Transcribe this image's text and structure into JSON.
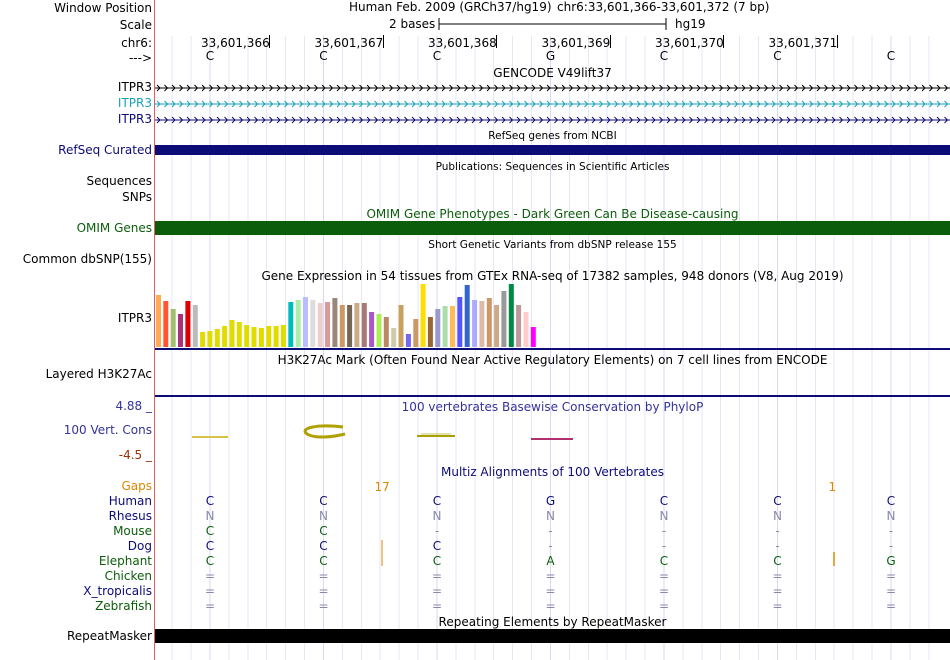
{
  "header": {
    "window_position_label": "Window Position",
    "scale_label": "Scale",
    "chrom_label": "chr6:",
    "direction_label": "--->",
    "assembly_text": "Human Feb. 2009 (GRCh37/hg19)",
    "position_text": "chr6:33,601,366-33,601,372 (7 bp)",
    "scale_text": "2 bases",
    "db_text": "hg19",
    "coordinates": [
      "33,601,366",
      "33,601,367",
      "33,601,368",
      "33,601,369",
      "33,601,370",
      "33,601,371"
    ],
    "sequence": [
      "C",
      "C",
      "C",
      "G",
      "C",
      "C",
      "C"
    ]
  },
  "gencode": {
    "title": "GENCODE V49lift37",
    "transcripts": [
      {
        "label": "ITPR3",
        "color": "#000000"
      },
      {
        "label": "ITPR3",
        "color": "#17a2b8"
      },
      {
        "label": "ITPR3",
        "color": "#0c0c78"
      }
    ]
  },
  "refseq": {
    "title": "RefSeq genes from NCBI",
    "label": "RefSeq Curated",
    "color": "#0c0c78"
  },
  "publications": {
    "title": "Publications: Sequences in Scientific Articles",
    "labels": [
      "Sequences",
      "SNPs"
    ]
  },
  "omim": {
    "title": "OMIM Gene Phenotypes - Dark Green Can Be Disease-causing",
    "label": "OMIM Genes",
    "color": "#0b5d0b"
  },
  "dbsnp": {
    "title": "Short Genetic Variants from dbSNP release 155",
    "label": "Common dbSNP(155)"
  },
  "gtex": {
    "title": "Gene Expression in 54 tissues from GTEx RNA-seq of 17382 samples, 948 donors (V8, Aug 2019)",
    "label": "ITPR3"
  },
  "chart_data": {
    "type": "bar",
    "title": "Gene Expression in 54 tissues from GTEx RNA-seq of 17382 samples, 948 donors (V8, Aug 2019)",
    "values": [
      52,
      46,
      38,
      33,
      46,
      42,
      15,
      16,
      18,
      21,
      27,
      25,
      22,
      20,
      19,
      21,
      21,
      22,
      45,
      47,
      50,
      47,
      44,
      45,
      49,
      42,
      42,
      44,
      44,
      35,
      33,
      30,
      19,
      42,
      13,
      28,
      63,
      30,
      38,
      41,
      41,
      50,
      62,
      47,
      46,
      49,
      42,
      56,
      63,
      42,
      35,
      20
    ],
    "colors": [
      "#ffaa55",
      "#ff5533",
      "#a0c070",
      "#aa3377",
      "#dd0000",
      "#bbbbbb",
      "#e0dc00",
      "#e0dc00",
      "#e0dc00",
      "#e0dc00",
      "#e0dc00",
      "#e0dc00",
      "#e0dc00",
      "#e0dc00",
      "#e0dc00",
      "#e0dc00",
      "#e0dc00",
      "#e0dc00",
      "#00bbbb",
      "#aaeeaa",
      "#bbbbff",
      "#dddddd",
      "#eecccc",
      "#dd9999",
      "#998877",
      "#cc9966",
      "#776655",
      "#ccaa88",
      "#aa7777",
      "#aa55cc",
      "#aaee55",
      "#bb8866",
      "#ccccaa",
      "#c8a060",
      "#7766ee",
      "#cc9966",
      "#ffdd00",
      "#996633",
      "#9999cc",
      "#aaddaa",
      "#ffbb55",
      "#5555ff",
      "#3366cc",
      "#aaaaff",
      "#ddbbaa",
      "#cc9966",
      "#ccaa88",
      "#999999",
      "#008844",
      "#bb9999",
      "#ffcccc",
      "#ff00ff"
    ]
  },
  "h3k27ac": {
    "title": "H3K27Ac Mark (Often Found Near Active Regulatory Elements) on 7 cell lines from ENCODE",
    "label": "Layered H3K27Ac"
  },
  "conservation": {
    "title": "100 vertebrates Basewise Conservation by PhyloP",
    "label": "100 Vert. Cons",
    "max_label": "4.88 _",
    "min_label": "-4.5 _",
    "label_color": "#333399",
    "min_color": "#993300"
  },
  "multiz": {
    "title": "Multiz Alignments of 100 Vertebrates",
    "gaps_label": "Gaps",
    "gap_counts": [
      {
        "text": "17",
        "after_base": 1
      },
      {
        "text": "1",
        "after_base": 5
      }
    ],
    "gap_color": "#dd8800",
    "species": [
      {
        "name": "Human",
        "color": "#0c0c78",
        "bases": [
          "C",
          "C",
          "C",
          "G",
          "C",
          "C",
          "C"
        ],
        "base_color": "#0c0c78"
      },
      {
        "name": "Rhesus",
        "color": "#0c0c78",
        "bases": [
          "N",
          "N",
          "N",
          "N",
          "N",
          "N",
          "N"
        ],
        "base_color": "#8888aa"
      },
      {
        "name": "Mouse",
        "color": "#0b5d0b",
        "bases": [
          "C",
          "C",
          "-",
          "-",
          "-",
          "-",
          "-"
        ],
        "base_color": "#0b5d0b"
      },
      {
        "name": "Dog",
        "color": "#0c0c78",
        "bases": [
          "C",
          "C",
          "C",
          "-",
          "-",
          "-",
          "-"
        ],
        "base_color": "#0c0c78"
      },
      {
        "name": "Elephant",
        "color": "#0b5d0b",
        "bases": [
          "C",
          "C",
          "C",
          "A",
          "C",
          "C",
          "G"
        ],
        "base_color": "#0b5d0b"
      },
      {
        "name": "Chicken",
        "color": "#0b5d0b",
        "bases": [
          "=",
          "=",
          "=",
          "=",
          "=",
          "=",
          "="
        ],
        "base_color": "#7777aa"
      },
      {
        "name": "X_tropicalis",
        "color": "#0c0c78",
        "bases": [
          "=",
          "=",
          "=",
          "=",
          "=",
          "=",
          "="
        ],
        "base_color": "#7777aa"
      },
      {
        "name": "Zebrafish",
        "color": "#0b5d0b",
        "bases": [
          "=",
          "=",
          "=",
          "=",
          "=",
          "=",
          "="
        ],
        "base_color": "#7777aa"
      }
    ]
  },
  "repeatmasker": {
    "title": "Repeating Elements by RepeatMasker",
    "label": "RepeatMasker"
  }
}
